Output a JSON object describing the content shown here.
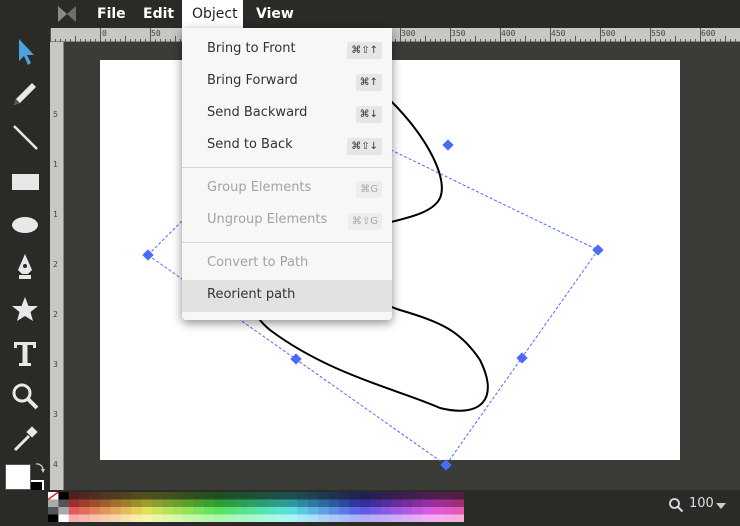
{
  "menubar": {
    "items": [
      {
        "label": "File"
      },
      {
        "label": "Edit"
      },
      {
        "label": "Object"
      },
      {
        "label": "View"
      }
    ]
  },
  "object_menu": {
    "items": [
      {
        "label": "Bring to Front",
        "shortcut": "⌘⇧↑",
        "enabled": true
      },
      {
        "label": "Bring Forward",
        "shortcut": "⌘↑",
        "enabled": true
      },
      {
        "label": "Send Backward",
        "shortcut": "⌘↓",
        "enabled": true
      },
      {
        "label": "Send to Back",
        "shortcut": "⌘⇧↓",
        "enabled": true
      },
      {
        "label": "Group Elements",
        "shortcut": "⌘G",
        "enabled": false
      },
      {
        "label": "Ungroup Elements",
        "shortcut": "⌘⇧G",
        "enabled": false
      },
      {
        "label": "Convert to Path",
        "shortcut": "",
        "enabled": false
      },
      {
        "label": "Reorient path",
        "shortcut": "",
        "enabled": true,
        "highlighted": true
      }
    ]
  },
  "ruler": {
    "top_ticks": [
      "0",
      "50",
      "300",
      "350",
      "400",
      "450",
      "500",
      "550",
      "600"
    ],
    "left_ticks": [
      "5",
      "1",
      "1",
      "2",
      "2",
      "3",
      "3",
      "4"
    ]
  },
  "zoom": {
    "value": "100"
  },
  "colors": {
    "accent": "#4aa3df",
    "selection": "#4a6cf7",
    "fill": "#ffffff",
    "stroke": "#000000"
  },
  "toolbar": {
    "tools": [
      "select-icon",
      "pencil-icon",
      "line-icon",
      "rectangle-icon",
      "ellipse-icon",
      "pen-icon",
      "star-icon",
      "text-icon",
      "zoom-icon",
      "eyedropper-icon"
    ]
  }
}
